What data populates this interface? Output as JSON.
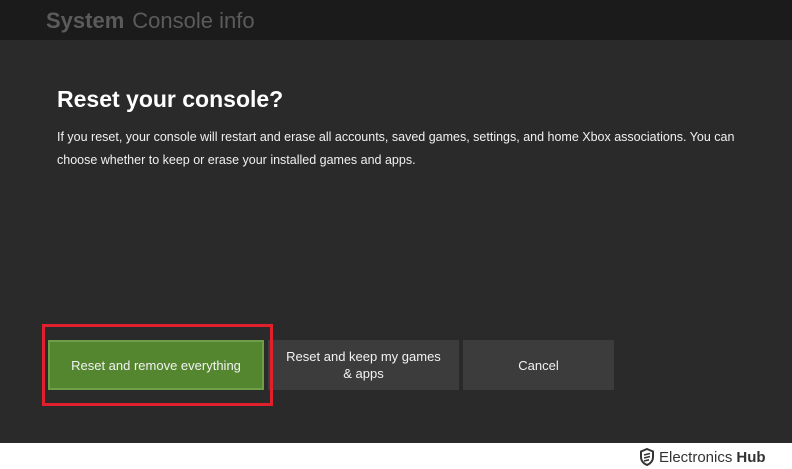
{
  "header": {
    "section": "System",
    "page": "Console info"
  },
  "dialog": {
    "heading": "Reset your console?",
    "body": "If you reset, your console will restart and erase all accounts, saved games, settings, and home Xbox associations. You can choose whether to keep or erase your installed games and apps."
  },
  "buttons": {
    "reset_remove": "Reset and remove everything",
    "reset_keep": "Reset and keep my games & apps",
    "cancel": "Cancel"
  },
  "colors": {
    "primary_button": "#54862f",
    "highlight": "#e0202c",
    "background": "#2a2a2a"
  },
  "watermark": {
    "brand": "Electronics",
    "suffix": "Hub",
    "icon": "electronicshub-logo-icon"
  }
}
